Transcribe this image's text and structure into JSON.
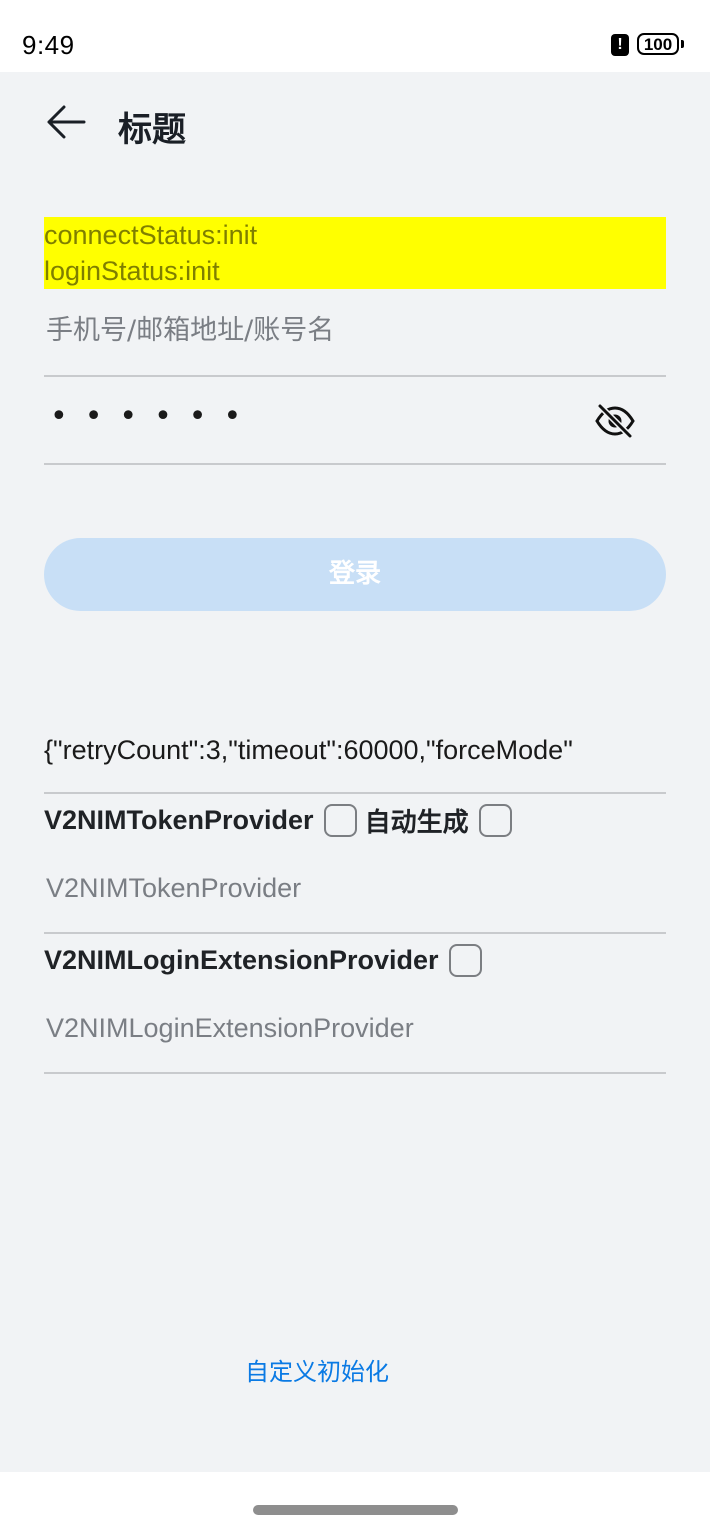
{
  "status_bar": {
    "time": "9:49",
    "alert_glyph": "!",
    "battery": "100"
  },
  "header": {
    "back_icon": "arrow-left-icon",
    "title": "标题"
  },
  "status_box": {
    "connect_status": "connectStatus:init",
    "login_status": "loginStatus:init",
    "background_color": "#ffff00",
    "text_color": "#7f7f00"
  },
  "form": {
    "account_placeholder": "手机号/邮箱地址/账号名",
    "account_value": "",
    "password_masked": "••••••",
    "password_toggle_icon": "eye-slash-icon",
    "login_button_label": "登录",
    "login_button_color": "#c8dff6"
  },
  "options": {
    "json_text": "{\"retryCount\":3,\"timeout\":60000,\"forceMode\"",
    "token_provider_label": "V2NIMTokenProvider",
    "token_provider_checked": false,
    "auto_generate_label": "自动生成",
    "auto_generate_checked": false,
    "token_provider_placeholder": "V2NIMTokenProvider",
    "login_extension_label": "V2NIMLoginExtensionProvider",
    "login_extension_checked": false,
    "login_extension_placeholder": "V2NIMLoginExtensionProvider"
  },
  "footer": {
    "custom_init_link": "自定义初始化",
    "link_color": "#0a7ae4"
  }
}
